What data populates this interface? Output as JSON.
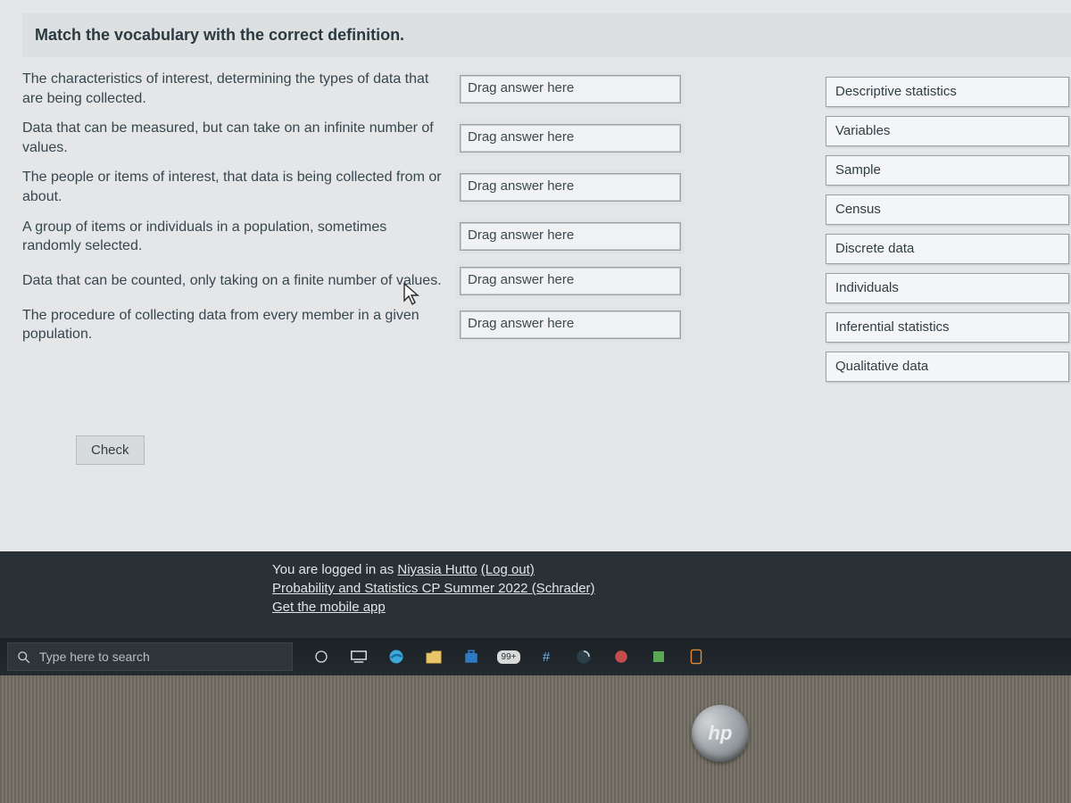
{
  "question": {
    "title": "Match the vocabulary with the correct definition.",
    "definitions": [
      "The characteristics of interest, determining the types of data that are being collected.",
      "Data that can be measured, but can take on an infinite number of values.",
      "The people or items of interest, that data is being collected from or about.",
      "A group of items or individuals in a population, sometimes randomly selected.",
      "Data that can be counted, only taking on a finite number of values.",
      "The procedure of collecting data from every member in a given population."
    ],
    "dropzone_placeholder": "Drag answer here",
    "answers": [
      "Descriptive statistics",
      "Variables",
      "Sample",
      "Census",
      "Discrete data",
      "Individuals",
      "Inferential statistics",
      "Qualitative data"
    ],
    "check_label": "Check"
  },
  "footer": {
    "logged_in_prefix": "You are logged in as ",
    "user": "Niyasia Hutto",
    "logout": "(Log out)",
    "course": "Probability and Statistics CP Summer 2022 (Schrader)",
    "mobile": "Get the mobile app"
  },
  "taskbar": {
    "search_placeholder": "Type here to search",
    "badge": "99+"
  }
}
